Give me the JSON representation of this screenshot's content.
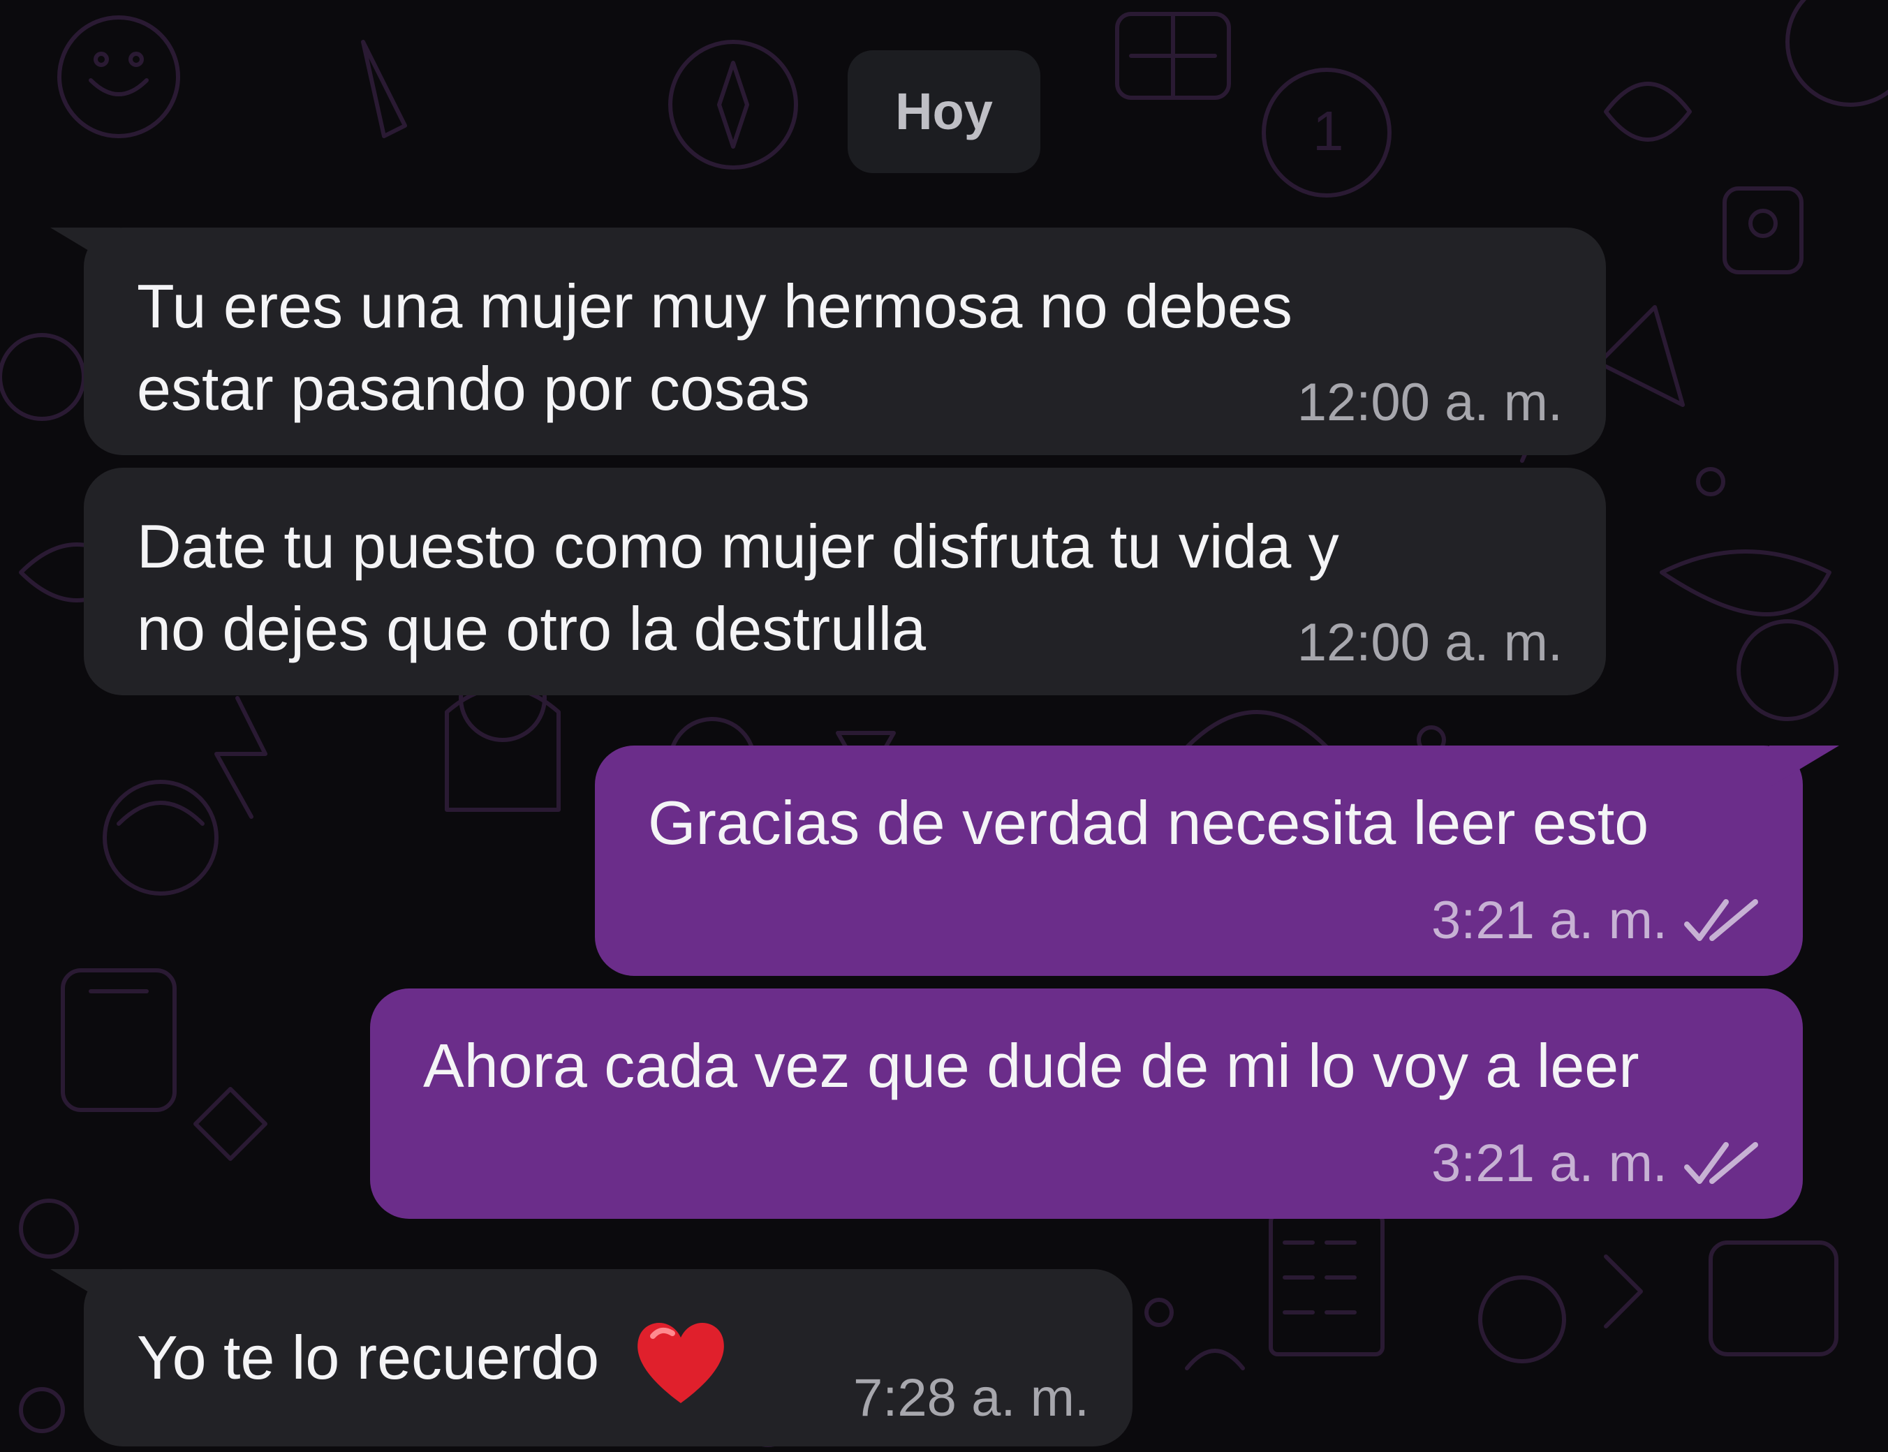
{
  "date_separator": "Hoy",
  "messages": [
    {
      "direction": "incoming",
      "lines": [
        "Tu eres una mujer muy hermosa no debes",
        "estar pasando por cosas"
      ],
      "time": "12:00 a. m."
    },
    {
      "direction": "incoming",
      "lines": [
        "Date tu puesto como mujer disfruta tu vida y",
        "no dejes que otro la destrulla"
      ],
      "time": "12:00 a. m."
    },
    {
      "direction": "outgoing",
      "text": "Gracias de verdad necesita leer esto",
      "time": "3:21 a. m.",
      "status": "read-double-check"
    },
    {
      "direction": "outgoing",
      "text": "Ahora cada vez que dude de mi lo voy a leer",
      "time": "3:21 a. m.",
      "status": "read-double-check"
    },
    {
      "direction": "incoming",
      "text": "Yo te lo recuerdo",
      "emoji": "heart-emoji",
      "time": "7:28 a. m."
    }
  ],
  "colors": {
    "background": "#0b0a0d",
    "wallpaper_doodle": "#2a1a33",
    "incoming_bubble": "#222226",
    "outgoing_bubble": "#6b2d8a",
    "date_chip": "#1c1d21",
    "heart": "#e0202c"
  }
}
